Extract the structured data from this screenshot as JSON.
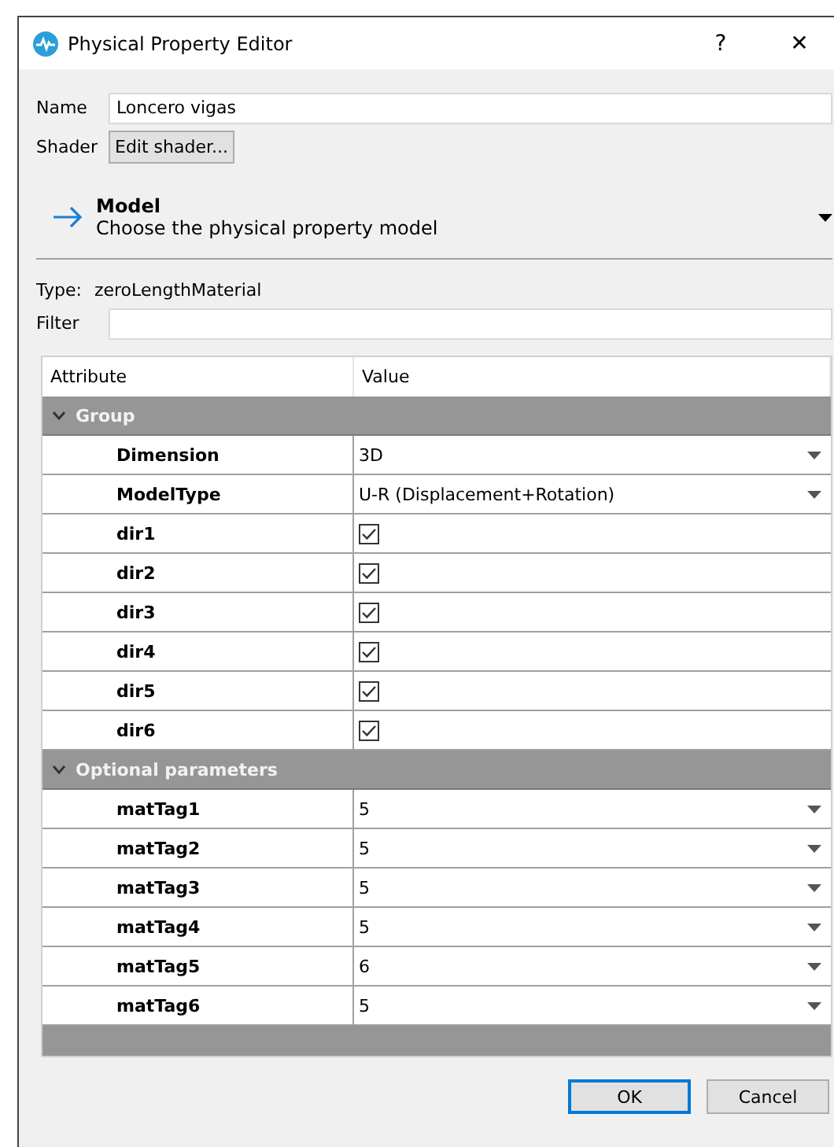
{
  "window": {
    "title": "Physical Property Editor",
    "help": "?",
    "close": "✕"
  },
  "name": {
    "label": "Name",
    "value": "Loncero vigas"
  },
  "shader": {
    "label": "Shader",
    "button": "Edit shader..."
  },
  "model": {
    "title": "Model",
    "subtitle": "Choose the physical property model"
  },
  "type": {
    "label": "Type:",
    "value": "zeroLengthMaterial"
  },
  "filter": {
    "label": "Filter"
  },
  "table": {
    "columns": [
      "Attribute",
      "Value"
    ],
    "groups": [
      {
        "title": "Group",
        "expanded": true,
        "rows": [
          {
            "name": "Dimension",
            "kind": "combo",
            "value": "3D"
          },
          {
            "name": "ModelType",
            "kind": "combo",
            "value": "U-R (Displacement+Rotation)"
          },
          {
            "name": "dir1",
            "kind": "check",
            "checked": true
          },
          {
            "name": "dir2",
            "kind": "check",
            "checked": true
          },
          {
            "name": "dir3",
            "kind": "check",
            "checked": true
          },
          {
            "name": "dir4",
            "kind": "check",
            "checked": true
          },
          {
            "name": "dir5",
            "kind": "check",
            "checked": true
          },
          {
            "name": "dir6",
            "kind": "check",
            "checked": true
          }
        ]
      },
      {
        "title": "Optional parameters",
        "expanded": true,
        "rows": [
          {
            "name": "matTag1",
            "kind": "combo",
            "value": "5"
          },
          {
            "name": "matTag2",
            "kind": "combo",
            "value": "5"
          },
          {
            "name": "matTag3",
            "kind": "combo",
            "value": "5"
          },
          {
            "name": "matTag4",
            "kind": "combo",
            "value": "5"
          },
          {
            "name": "matTag5",
            "kind": "combo",
            "value": "6"
          },
          {
            "name": "matTag6",
            "kind": "combo",
            "value": "5"
          }
        ]
      }
    ]
  },
  "buttons": [
    {
      "label": "OK",
      "default": true
    },
    {
      "label": "Cancel",
      "default": false
    }
  ]
}
